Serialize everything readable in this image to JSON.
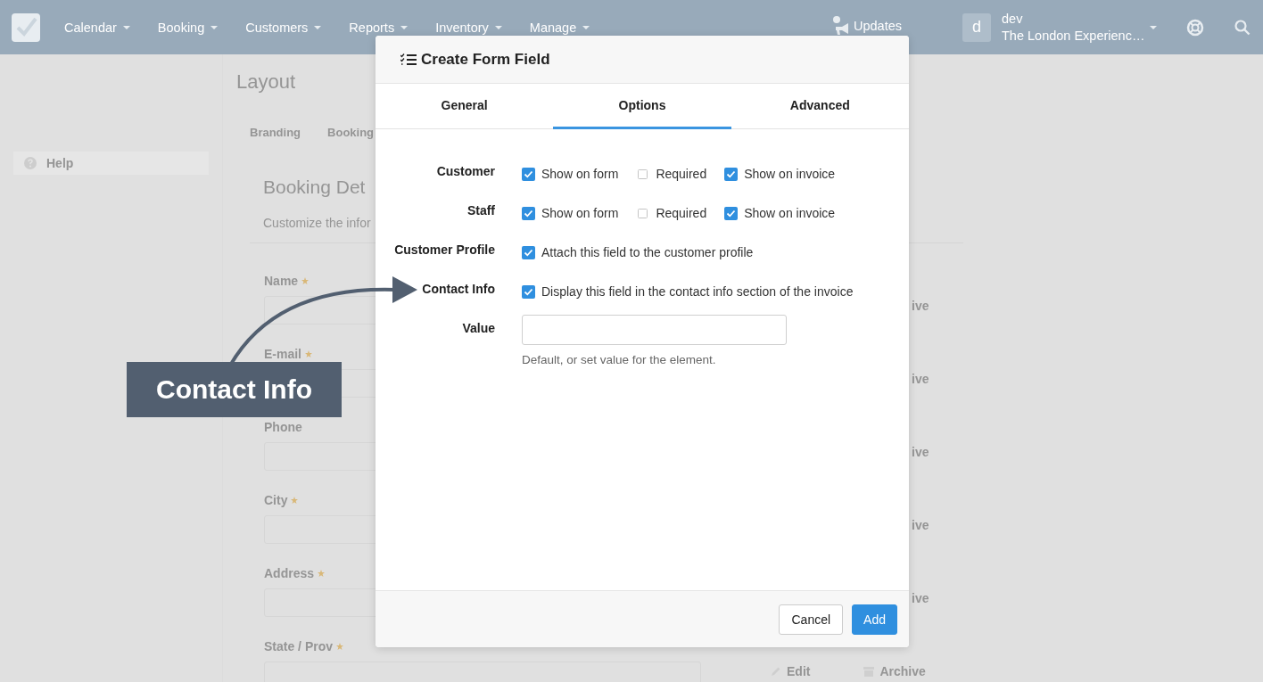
{
  "top_nav": {
    "items": [
      {
        "label": "Calendar"
      },
      {
        "label": "Booking"
      },
      {
        "label": "Customers"
      },
      {
        "label": "Reports"
      },
      {
        "label": "Inventory"
      },
      {
        "label": "Manage"
      }
    ],
    "updates": "Updates",
    "user": {
      "initial": "d",
      "name": "dev",
      "account": "The London Experienc…"
    }
  },
  "sidebar": {
    "items": [
      {
        "label": "Help"
      }
    ]
  },
  "page": {
    "title": "Layout",
    "tabs": [
      {
        "label": "Branding"
      },
      {
        "label": "Booking"
      }
    ],
    "section": {
      "title": "Booking Det",
      "description": "Customize the infor",
      "fields": [
        {
          "label": "Name",
          "required": true,
          "actions": [
            {
              "kind": "cut",
              "label": "ive"
            }
          ]
        },
        {
          "label": "E-mail",
          "required": true,
          "actions": [
            {
              "kind": "cut",
              "label": "ive"
            }
          ]
        },
        {
          "label": "Phone",
          "required": false,
          "actions": [
            {
              "kind": "cut",
              "label": "ive"
            }
          ]
        },
        {
          "label": "City",
          "required": true,
          "actions": [
            {
              "kind": "cut",
              "label": "ive"
            }
          ]
        },
        {
          "label": "Address",
          "required": true,
          "actions": [
            {
              "kind": "cut",
              "label": "ive"
            }
          ]
        },
        {
          "label": "State / Prov",
          "required": true,
          "actions": [
            {
              "kind": "edit",
              "label": "Edit"
            },
            {
              "kind": "archive",
              "label": "Archive"
            }
          ]
        }
      ]
    }
  },
  "modal": {
    "title": "Create Form Field",
    "tabs": [
      {
        "label": "General",
        "selected": false
      },
      {
        "label": "Options",
        "selected": true
      },
      {
        "label": "Advanced",
        "selected": false
      }
    ],
    "options": [
      {
        "label": "Customer",
        "checkboxes": [
          {
            "label": "Show on form",
            "checked": true
          },
          {
            "label": "Required",
            "checked": false
          },
          {
            "label": "Show on invoice",
            "checked": true
          }
        ]
      },
      {
        "label": "Staff",
        "checkboxes": [
          {
            "label": "Show on form",
            "checked": true
          },
          {
            "label": "Required",
            "checked": false
          },
          {
            "label": "Show on invoice",
            "checked": true
          }
        ]
      },
      {
        "label": "Customer Profile",
        "checkboxes": [
          {
            "label": "Attach this field to the customer profile",
            "checked": true
          }
        ]
      },
      {
        "label": "Contact Info",
        "checkboxes": [
          {
            "label": "Display this field in the contact info section of the invoice",
            "checked": true
          }
        ]
      }
    ],
    "value": {
      "label": "Value",
      "help": "Default, or set value for the element."
    },
    "buttons": [
      {
        "label": "Cancel",
        "kind": "default"
      },
      {
        "label": "Add",
        "kind": "primary"
      }
    ]
  },
  "callout": {
    "label": "Contact Info"
  }
}
